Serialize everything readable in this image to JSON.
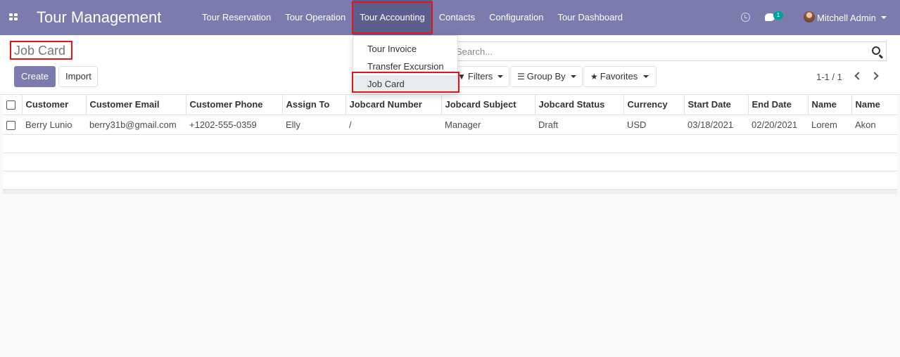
{
  "navbar": {
    "brand": "Tour Management",
    "menu": [
      "Tour Reservation",
      "Tour Operation",
      "Tour Accounting",
      "Contacts",
      "Configuration",
      "Tour Dashboard"
    ],
    "active_menu": "Tour Accounting",
    "chat_count": "1",
    "user_name": "Mitchell Admin"
  },
  "dropdown": {
    "items": [
      "Tour Invoice",
      "Transfer Excursion",
      "Job Card"
    ],
    "active_item": "Job Card"
  },
  "control_panel": {
    "title": "Job Card",
    "create_label": "Create",
    "import_label": "Import",
    "search_placeholder": "Search...",
    "filters_label": "Filters",
    "group_by_label": "Group By",
    "favorites_label": "Favorites",
    "pager": "1-1 / 1"
  },
  "table": {
    "columns": [
      "Customer",
      "Customer Email",
      "Customer Phone",
      "Assign To",
      "Jobcard Number",
      "Jobcard Subject",
      "Jobcard Status",
      "Currency",
      "Start Date",
      "End Date",
      "Name",
      "Name"
    ],
    "rows": [
      [
        "Berry Lunio",
        "berry31b@gmail.com",
        "+1202-555-0359",
        "Elly",
        "/",
        "Manager",
        "Draft",
        "USD",
        "03/18/2021",
        "02/20/2021",
        "Lorem",
        "Akon"
      ]
    ]
  },
  "colors": {
    "brand": "#7c7bad",
    "highlight": "#e3151a",
    "badge": "#00a09d"
  }
}
